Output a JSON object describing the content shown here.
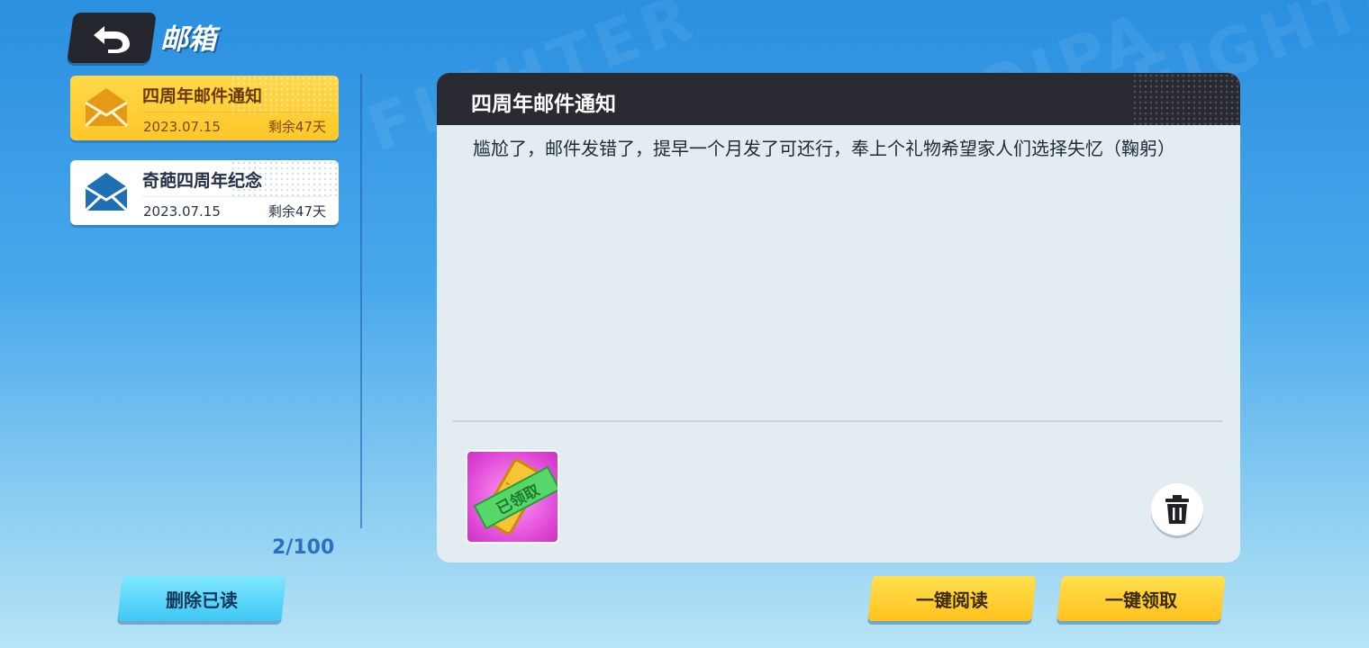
{
  "header": {
    "title": "邮箱",
    "back_icon": "back-arrow-icon"
  },
  "mail_list": {
    "items": [
      {
        "title": "四周年邮件通知",
        "date": "2023.07.15",
        "remaining": "剩余47天",
        "selected": true,
        "icon": "envelope-open-icon"
      },
      {
        "title": "奇葩四周年纪念",
        "date": "2023.07.15",
        "remaining": "剩余47天",
        "selected": false,
        "icon": "envelope-icon"
      }
    ],
    "count": "2/100"
  },
  "detail": {
    "title": "四周年邮件通知",
    "body": "尴尬了，邮件发错了，提早一个月发了可还行，奉上个礼物希望家人们选择失忆（鞠躬）",
    "attachment": {
      "icon": "ticket-icon",
      "status": "已领取"
    },
    "delete_icon": "trash-icon"
  },
  "buttons": {
    "delete_read": "删除已读",
    "read_all": "一键阅读",
    "claim_all": "一键领取"
  },
  "colors": {
    "accent_yellow": "#ffc72a",
    "panel_dark": "#2a2a33",
    "button_blue": "#3fc8f4"
  }
}
